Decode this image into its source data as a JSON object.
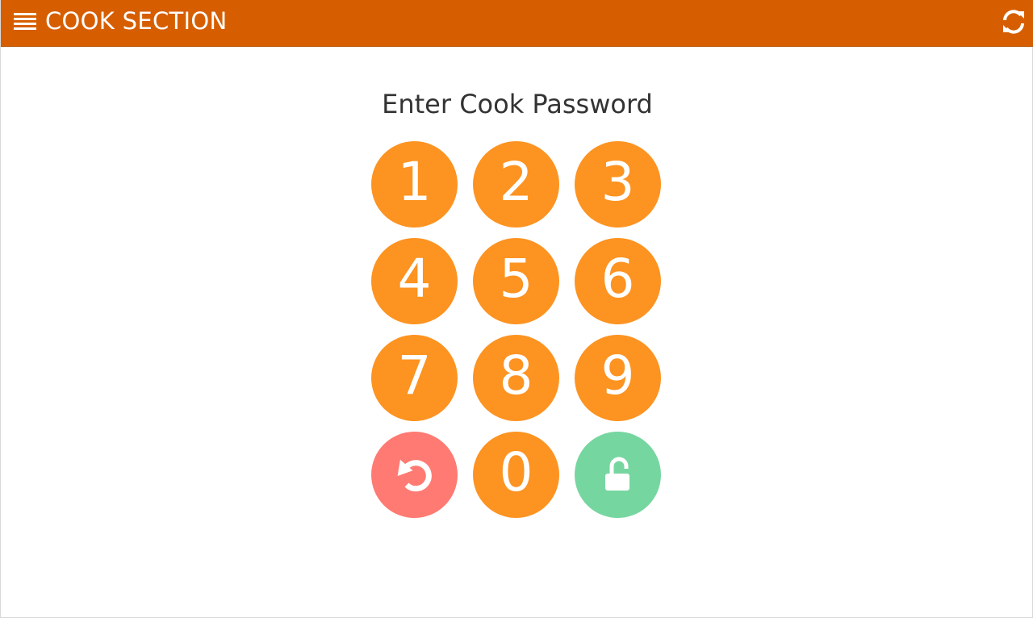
{
  "header": {
    "title": "COOK SECTION",
    "menu_icon": "hamburger-menu-icon",
    "refresh_icon": "refresh-icon"
  },
  "main": {
    "prompt": "Enter Cook Password"
  },
  "keypad": {
    "keys": [
      "1",
      "2",
      "3",
      "4",
      "5",
      "6",
      "7",
      "8",
      "9"
    ],
    "zero": "0",
    "reset_icon": "undo-icon",
    "unlock_icon": "unlock-icon"
  },
  "colors": {
    "header_bg": "#d65e00",
    "digit_key": "#fd9321",
    "reset_key": "#ff7a72",
    "unlock_key": "#76d6a0",
    "text": "#333333"
  }
}
